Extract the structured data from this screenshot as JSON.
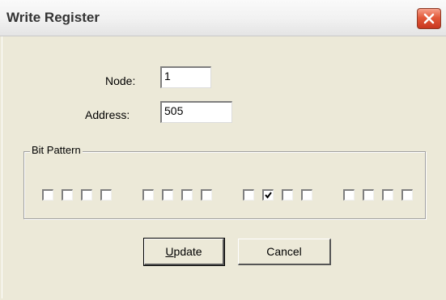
{
  "window": {
    "title": "Write Register",
    "close_icon": "close-icon"
  },
  "form": {
    "node_label": "Node:",
    "node_value": "1",
    "address_label": "Address:",
    "address_value": "505"
  },
  "bit_pattern": {
    "label": "Bit Pattern",
    "bits": [
      false,
      false,
      false,
      false,
      false,
      false,
      false,
      false,
      false,
      true,
      false,
      false,
      false,
      false,
      false,
      false
    ]
  },
  "buttons": {
    "update_mnemonic": "U",
    "update_rest": "pdate",
    "cancel": "Cancel"
  },
  "colors": {
    "dialog_bg": "#ece9d8",
    "close_red": "#d9442a"
  }
}
